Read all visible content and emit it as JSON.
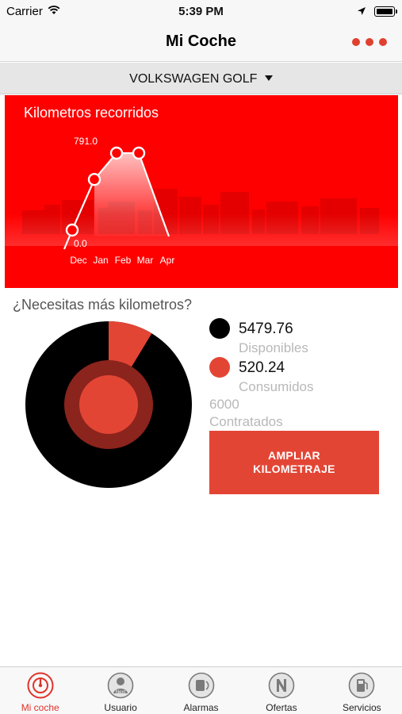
{
  "status_bar": {
    "carrier": "Carrier",
    "time": "5:39 PM"
  },
  "nav": {
    "title": "Mi Coche",
    "more_icon": "more-dots-icon"
  },
  "car_selector": {
    "label": "VOLKSWAGEN GOLF"
  },
  "chart_data": {
    "type": "line",
    "title": "Kilometros recorridos",
    "categories": [
      "Dec",
      "Jan",
      "Feb",
      "Mar",
      "Apr"
    ],
    "series": [
      {
        "values": [
          0.0,
          520.24,
          791.0,
          791.0,
          791.0
        ]
      }
    ],
    "point_labels": {
      "max": "791.0",
      "min": "0.0"
    },
    "ylim": [
      0,
      791.0
    ],
    "grid": false,
    "colors": {
      "background": "#ff0000",
      "line": "#ffffff"
    }
  },
  "usage": {
    "question": "¿Necesitas más kilometros?",
    "disponibles_value": "5479.76",
    "disponibles_label": "Disponibles",
    "consumidos_value": "520.24",
    "consumidos_label": "Consumidos",
    "contratados_value": "6000",
    "contratados_label": "Contratados",
    "consumed_fraction": 0.0867,
    "colors": {
      "disponibles": "#000000",
      "consumidos": "#e34535"
    }
  },
  "ampliar_button": {
    "line1": "AMPLIAR",
    "line2": "KILOMETRAJE"
  },
  "tab_bar": {
    "items": [
      {
        "label": "Mi coche",
        "icon": "speedometer-icon",
        "active": true
      },
      {
        "label": "Usuario",
        "icon": "user-icon",
        "active": false
      },
      {
        "label": "Alarmas",
        "icon": "alarm-icon",
        "active": false
      },
      {
        "label": "Ofertas",
        "icon": "offers-icon",
        "active": false
      },
      {
        "label": "Servicios",
        "icon": "fuel-pump-icon",
        "active": false
      }
    ]
  }
}
